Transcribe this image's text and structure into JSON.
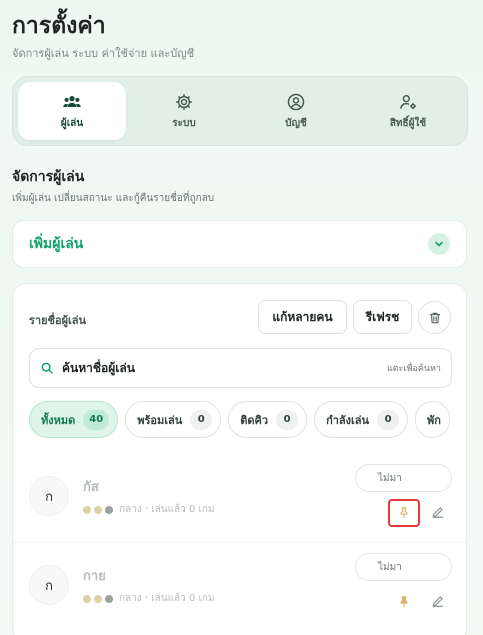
{
  "page": {
    "title": "การตั้งค่า",
    "subtitle": "จัดการผู้เล่น ระบบ ค่าใช้จ่าย และบัญชี"
  },
  "tabs": [
    {
      "label": "ผู้เล่น",
      "icon": "users-icon",
      "active": true
    },
    {
      "label": "ระบบ",
      "icon": "gear-icon",
      "active": false
    },
    {
      "label": "บัญชี",
      "icon": "user-circle-icon",
      "active": false
    },
    {
      "label": "สิทธิ์ผู้ใช้",
      "icon": "user-settings-icon",
      "active": false
    }
  ],
  "section": {
    "title": "จัดการผู้เล่น",
    "subtitle": "เพิ่มผู้เล่น เปลี่ยนสถานะ และกู้คืนรายชื่อที่ถูกลบ"
  },
  "add_player": {
    "title": "เพิ่มผู้เล่น"
  },
  "player_list": {
    "title": "รายชื่อผู้เล่น",
    "multi_edit_label": "แก้หลายคน",
    "refresh_label": "รีเฟรช",
    "search_value": "ค้นหาชื่อผู้เล่น",
    "search_hint": "แตะเพื่อค้นหา",
    "filters": [
      {
        "label": "ทั้งหมด",
        "count": "40",
        "active": true
      },
      {
        "label": "พร้อมเล่น",
        "count": "0",
        "active": false
      },
      {
        "label": "ติดคิว",
        "count": "0",
        "active": false
      },
      {
        "label": "กำลังเล่น",
        "count": "0",
        "active": false
      },
      {
        "label": "พัก",
        "count": "",
        "active": false
      }
    ],
    "players": [
      {
        "initial": "ก",
        "name": "กัส",
        "meta": "กลาง · เล่นแล้ว 0 เกม",
        "status": "ไม่มา",
        "pin_highlighted": true
      },
      {
        "initial": "ก",
        "name": "กาย",
        "meta": "กลาง · เล่นแล้ว 0 เกม",
        "status": "ไม่มา",
        "pin_highlighted": false
      }
    ]
  },
  "colors": {
    "accent": "#12a36a",
    "pin_gold": "#d9b56a",
    "highlight": "#e53935"
  }
}
